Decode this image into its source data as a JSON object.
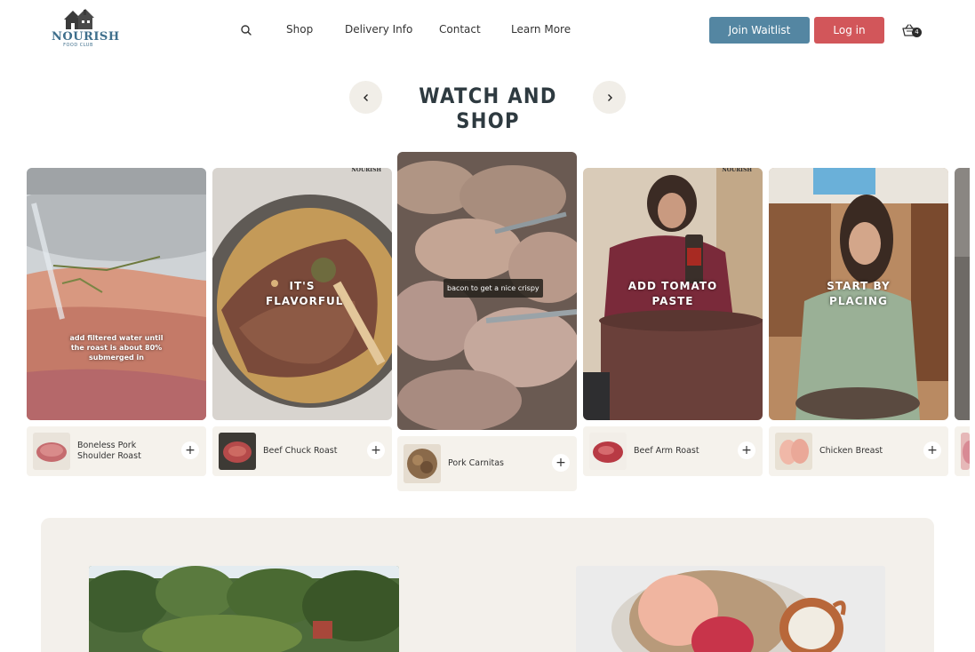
{
  "header": {
    "logo": {
      "name": "NOURISH",
      "sub": "FOOD CLUB"
    },
    "search_icon": "search-icon",
    "nav": [
      "Shop",
      "Delivery Info",
      "Contact",
      "Learn More"
    ],
    "join_waitlist": "Join Waitlist",
    "login": "Log in",
    "cart_count": "4",
    "colors": {
      "waitlist": "#5486a2",
      "login": "#d2565a"
    }
  },
  "section": {
    "title": "WATCH AND SHOP",
    "prev_icon": "chevron-left-icon",
    "next_icon": "chevron-right-icon"
  },
  "videos": [
    {
      "caption": "add filtered water until the roast is about 80% submerged in",
      "product": "Boneless Pork Shoulder Roast"
    },
    {
      "caption": "IT'S FLAVORFUL",
      "watermark": "NOURISH",
      "product": "Beef Chuck Roast"
    },
    {
      "caption": "bacon to get a nice crispy",
      "product": "Pork Carnitas"
    },
    {
      "caption": "ADD TOMATO PASTE",
      "watermark": "NOURISH",
      "product": "Beef Arm Roast"
    },
    {
      "caption": "START BY PLACING",
      "product": "Chicken Breast"
    }
  ]
}
